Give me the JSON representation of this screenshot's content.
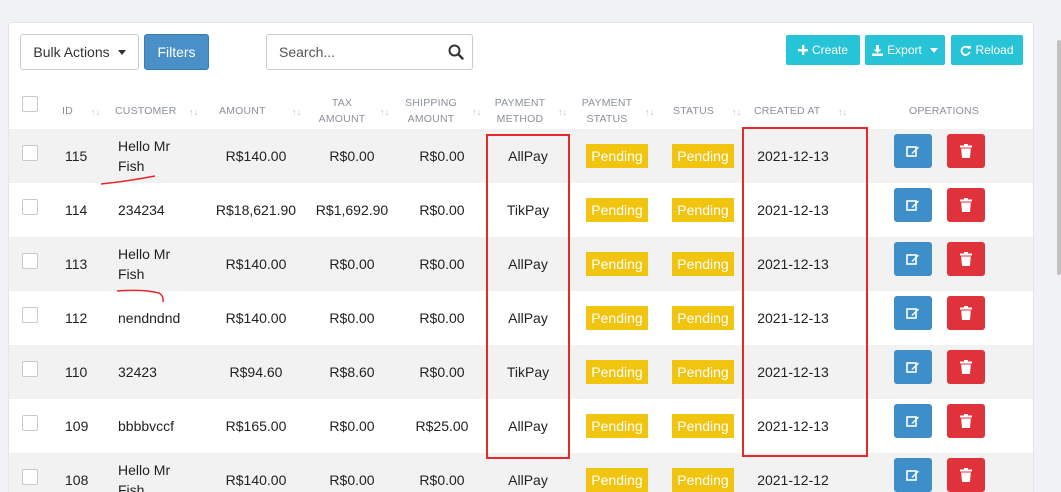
{
  "toolbar": {
    "bulk_actions": "Bulk Actions",
    "filters": "Filters",
    "search_placeholder": "Search...",
    "create": "Create",
    "export": "Export",
    "reload": "Reload"
  },
  "columns": {
    "id": "ID",
    "customer": "CUSTOMER",
    "amount": "AMOUNT",
    "tax_1": "TAX",
    "tax_2": "AMOUNT",
    "ship_1": "SHIPPING",
    "ship_2": "AMOUNT",
    "pm_1": "PAYMENT",
    "pm_2": "METHOD",
    "ps_1": "PAYMENT",
    "ps_2": "STATUS",
    "status": "STATUS",
    "created": "CREATED AT",
    "ops": "OPERATIONS"
  },
  "rows": [
    {
      "id": "115",
      "customer": "Hello Mr Fish",
      "amount": "R$140.00",
      "tax": "R$0.00",
      "shipping": "R$0.00",
      "method": "AllPay",
      "pay_status": "Pending",
      "status": "Pending",
      "created": "2021-12-13"
    },
    {
      "id": "114",
      "customer": "234234",
      "amount": "R$18,621.90",
      "tax": "R$1,692.90",
      "shipping": "R$0.00",
      "method": "TikPay",
      "pay_status": "Pending",
      "status": "Pending",
      "created": "2021-12-13"
    },
    {
      "id": "113",
      "customer": "Hello Mr Fish",
      "amount": "R$140.00",
      "tax": "R$0.00",
      "shipping": "R$0.00",
      "method": "AllPay",
      "pay_status": "Pending",
      "status": "Pending",
      "created": "2021-12-13"
    },
    {
      "id": "112",
      "customer": "nendndnd",
      "amount": "R$140.00",
      "tax": "R$0.00",
      "shipping": "R$0.00",
      "method": "AllPay",
      "pay_status": "Pending",
      "status": "Pending",
      "created": "2021-12-13"
    },
    {
      "id": "110",
      "customer": "32423",
      "amount": "R$94.60",
      "tax": "R$8.60",
      "shipping": "R$0.00",
      "method": "TikPay",
      "pay_status": "Pending",
      "status": "Pending",
      "created": "2021-12-13"
    },
    {
      "id": "109",
      "customer": "bbbbvccf",
      "amount": "R$165.00",
      "tax": "R$0.00",
      "shipping": "R$25.00",
      "method": "AllPay",
      "pay_status": "Pending",
      "status": "Pending",
      "created": "2021-12-13"
    },
    {
      "id": "108",
      "customer": "Hello Mr Fish",
      "amount": "R$140.00",
      "tax": "R$0.00",
      "shipping": "R$0.00",
      "method": "AllPay",
      "pay_status": "Pending",
      "status": "Pending",
      "created": "2021-12-12"
    }
  ],
  "icons": {
    "search": "search-icon",
    "create": "plus-icon",
    "export": "download-icon",
    "reload": "refresh-icon",
    "edit": "edit-icon",
    "delete": "trash-icon",
    "sort": "sort-icon"
  },
  "colors": {
    "primary": "#4a90c8",
    "teal": "#27c3d6",
    "pending": "#f1c40f",
    "edit": "#3d8ec9",
    "delete": "#e0323b",
    "annotation": "#e4282b"
  }
}
